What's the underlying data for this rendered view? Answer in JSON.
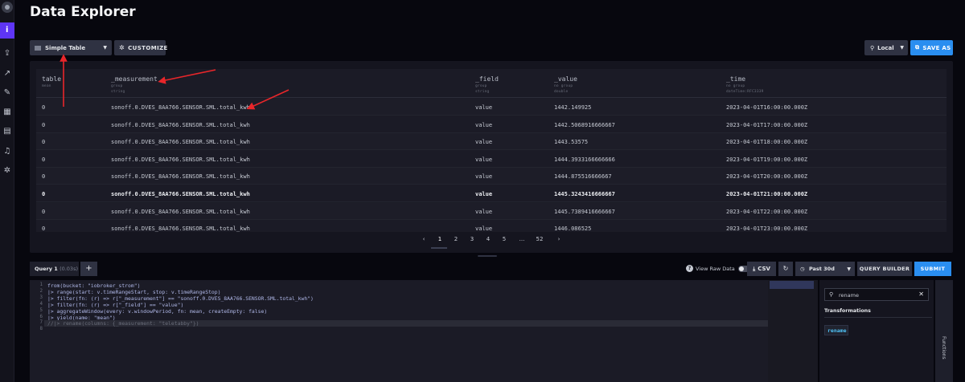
{
  "page": {
    "title": "Data Explorer"
  },
  "nav": {
    "active_label": "i",
    "icons": [
      "upload-icon",
      "chart-icon",
      "pencil-icon",
      "dashboard-icon",
      "calendar-icon",
      "bell-icon",
      "gear-icon"
    ]
  },
  "toolbar": {
    "viz_label": "Simple Table",
    "customize_label": "CUSTOMIZE",
    "timezone_label": "Local",
    "save_as_label": "SAVE AS"
  },
  "table": {
    "columns": [
      {
        "name": "table",
        "sub1": "mean",
        "sub2": ""
      },
      {
        "name": "_measurement",
        "sub1": "group",
        "sub2": "string"
      },
      {
        "name": "_field",
        "sub1": "group",
        "sub2": "string"
      },
      {
        "name": "_value",
        "sub1": "no group",
        "sub2": "double"
      },
      {
        "name": "_time",
        "sub1": "no group",
        "sub2": "dateTime:RFC3339"
      }
    ],
    "rows": [
      [
        "0",
        "sonoff.0.DVES_8AA766.SENSOR.SML.total_kwh",
        "value",
        "1442.149925",
        "2023-04-01T16:00:00.000Z"
      ],
      [
        "0",
        "sonoff.0.DVES_8AA766.SENSOR.SML.total_kwh",
        "value",
        "1442.5068916666667",
        "2023-04-01T17:00:00.000Z"
      ],
      [
        "0",
        "sonoff.0.DVES_8AA766.SENSOR.SML.total_kwh",
        "value",
        "1443.53575",
        "2023-04-01T18:00:00.000Z"
      ],
      [
        "0",
        "sonoff.0.DVES_8AA766.SENSOR.SML.total_kwh",
        "value",
        "1444.3933166666666",
        "2023-04-01T19:00:00.000Z"
      ],
      [
        "0",
        "sonoff.0.DVES_8AA766.SENSOR.SML.total_kwh",
        "value",
        "1444.875516666667",
        "2023-04-01T20:00:00.000Z"
      ],
      [
        "0",
        "sonoff.0.DVES_8AA766.SENSOR.SML.total_kwh",
        "value",
        "1445.3243416666667",
        "2023-04-01T21:00:00.000Z"
      ],
      [
        "0",
        "sonoff.0.DVES_8AA766.SENSOR.SML.total_kwh",
        "value",
        "1445.7389416666667",
        "2023-04-01T22:00:00.000Z"
      ],
      [
        "0",
        "sonoff.0.DVES_8AA766.SENSOR.SML.total_kwh",
        "value",
        "1446.086525",
        "2023-04-01T23:00:00.000Z"
      ]
    ],
    "bold_row_index": 5
  },
  "pagination": {
    "prev": "‹",
    "next": "›",
    "pages": [
      "1",
      "2",
      "3",
      "4",
      "5",
      "...",
      "52"
    ],
    "active_page": "1"
  },
  "query": {
    "tab_label": "Query 1",
    "tab_time": "(0.03s)",
    "add_label": "+",
    "raw_data_label": "View Raw Data",
    "raw_help": "?",
    "csv_label": "CSV",
    "range_label": "Past 30d",
    "builder_label": "QUERY BUILDER",
    "submit_label": "SUBMIT"
  },
  "editor": {
    "lines": [
      "from(bucket: \"iobroker_strom\")",
      "  |> range(start: v.timeRangeStart, stop: v.timeRangeStop)",
      "  |> filter(fn: (r) => r[\"_measurement\"] == \"sonoff.0.DVES_8AA766.SENSOR.SML.total_kwh\")",
      "  |> filter(fn: (r) => r[\"_field\"] == \"value\")",
      "  |> aggregateWindow(every: v.windowPeriod, fn: mean, createEmpty: false)",
      "  |> yield(name: \"mean\")",
      "  //|> rename(columns: {_measurement: \"teletabby\"})",
      ""
    ]
  },
  "functions": {
    "search_value": "rename",
    "section_title": "Transformations",
    "items": [
      "rename"
    ],
    "tab_label": "Functions"
  },
  "colors": {
    "accent_blue": "#2a8ef0",
    "nav_active": "#5e35f5",
    "annotation_red": "#e8262a"
  }
}
